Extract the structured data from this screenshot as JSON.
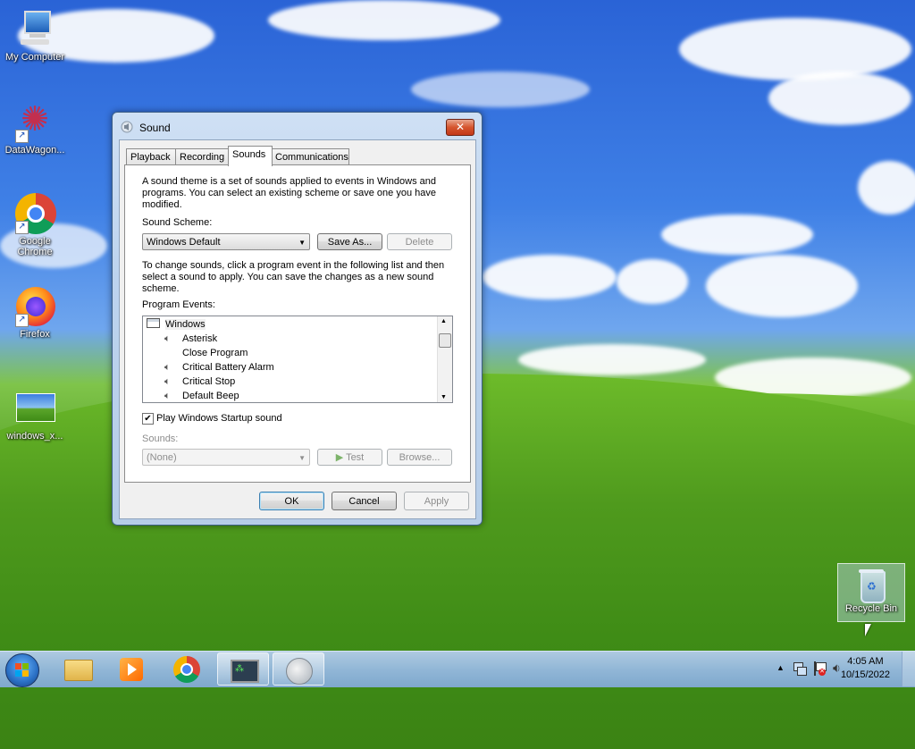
{
  "desktop": {
    "icons": [
      {
        "label": "My Computer"
      },
      {
        "label": "DataWagon..."
      },
      {
        "label": "Google\nChrome"
      },
      {
        "label": "Firefox"
      },
      {
        "label": "windows_x..."
      },
      {
        "label": "Recycle Bin"
      }
    ]
  },
  "dialog": {
    "title": "Sound",
    "close_label": "✕",
    "tabs": [
      "Playback",
      "Recording",
      "Sounds",
      "Communications"
    ],
    "active_tab": "Sounds",
    "description": "A sound theme is a set of sounds applied to events in Windows and programs.  You can select an existing scheme or save one you have modified.",
    "scheme_label": "Sound Scheme:",
    "scheme_value": "Windows Default",
    "save_as_label": "Save As...",
    "delete_label": "Delete",
    "instructions": "To change sounds, click a program event in the following list and then select a sound to apply.  You can save the changes as a new sound scheme.",
    "events_label": "Program Events:",
    "events": [
      {
        "label": "Windows",
        "type": "group"
      },
      {
        "label": "Asterisk",
        "type": "sound"
      },
      {
        "label": "Close Program",
        "type": "none"
      },
      {
        "label": "Critical Battery Alarm",
        "type": "sound"
      },
      {
        "label": "Critical Stop",
        "type": "sound"
      },
      {
        "label": "Default Beep",
        "type": "sound"
      }
    ],
    "startup_checkbox_label": "Play Windows Startup sound",
    "startup_checked": true,
    "sounds_label": "Sounds:",
    "sounds_value": "(None)",
    "test_label": "Test",
    "browse_label": "Browse...",
    "ok_label": "OK",
    "cancel_label": "Cancel",
    "apply_label": "Apply"
  },
  "taskbar": {
    "clock_time": "4:05 AM",
    "clock_date": "10/15/2022",
    "pinned": [
      "start-button",
      "file-explorer",
      "media-player",
      "chrome",
      "datawagon",
      "sound"
    ]
  }
}
